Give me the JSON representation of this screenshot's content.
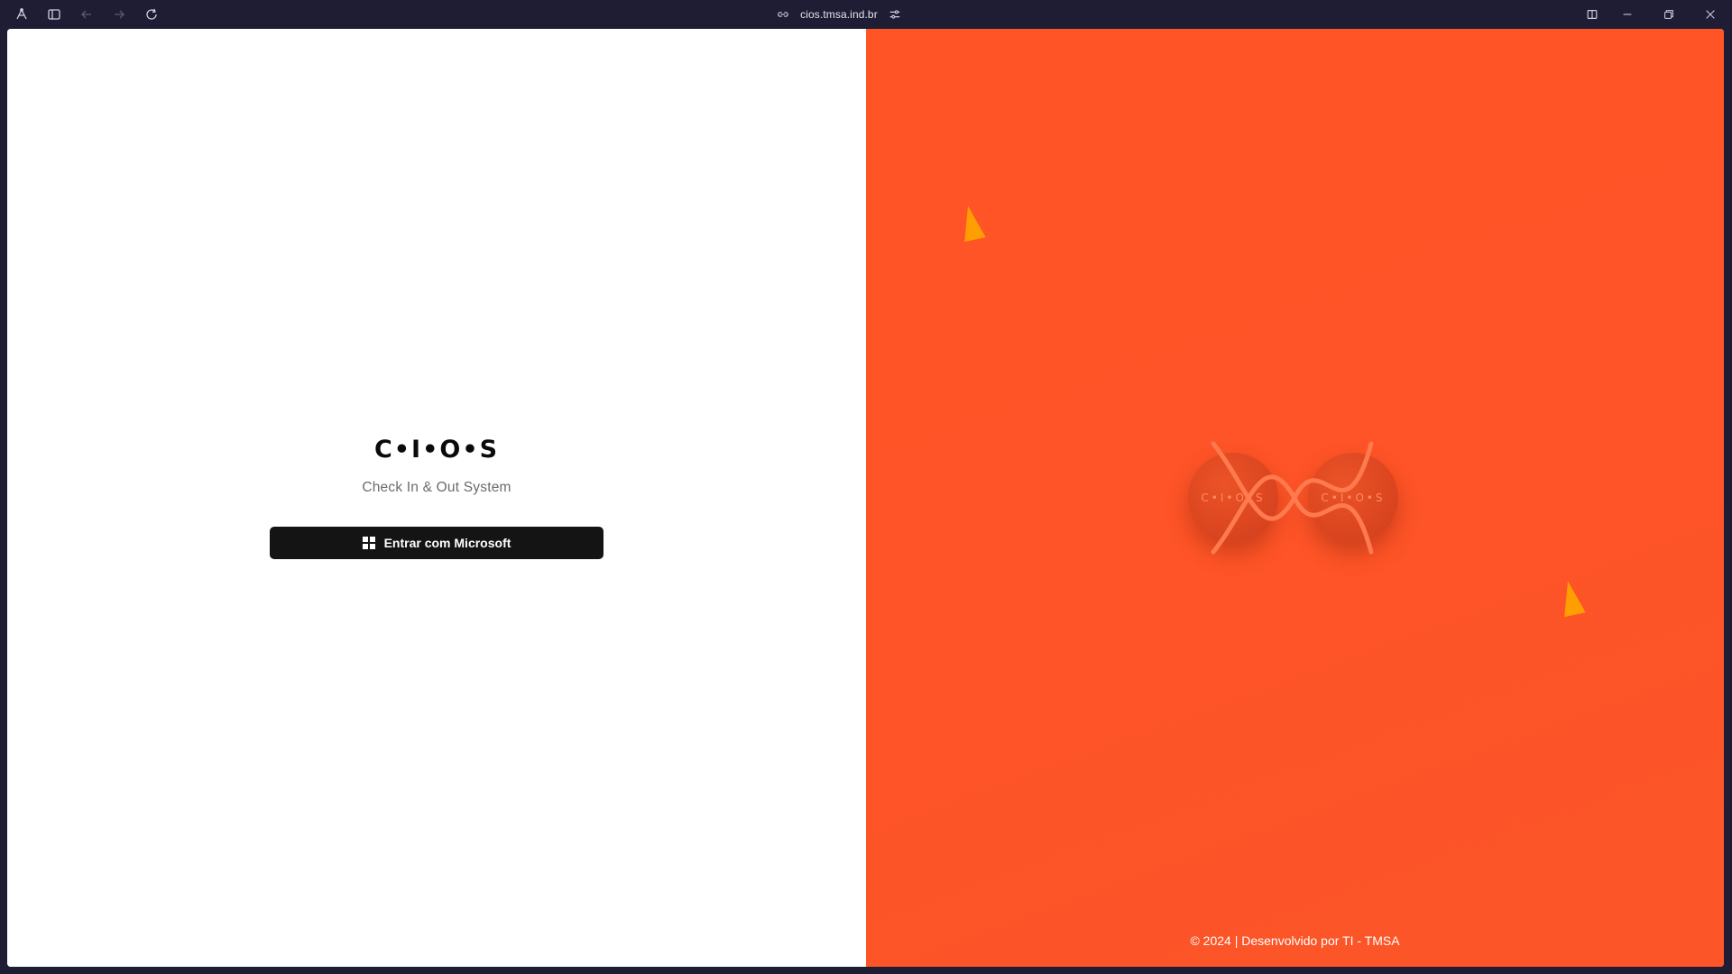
{
  "browser": {
    "url": "cios.tmsa.ind.br",
    "icons": {
      "logo": "browser-logo-icon",
      "sidebar": "sidebar-toggle-icon",
      "back": "arrow-left-icon",
      "forward": "arrow-right-icon",
      "reload": "reload-icon",
      "link": "link-icon",
      "site_settings": "sliders-icon",
      "split": "split-view-icon",
      "minimize": "minimize-icon",
      "maximize": "restore-icon",
      "close": "close-icon"
    }
  },
  "login": {
    "brand": "C•I•O•S",
    "subtitle": "Check In & Out System",
    "button_label": "Entrar com Microsoft",
    "button_icon": "windows-icon"
  },
  "hero": {
    "coin_left_text": "C•I•O•S",
    "coin_right_text": "C•I•O•S",
    "footer": "© 2024 | Desenvolvido por TI - TMSA"
  },
  "colors": {
    "chrome_bg": "#1f1d33",
    "accent_orange": "#ff5426",
    "triangle": "#ff9e00",
    "button_bg": "#141414"
  }
}
